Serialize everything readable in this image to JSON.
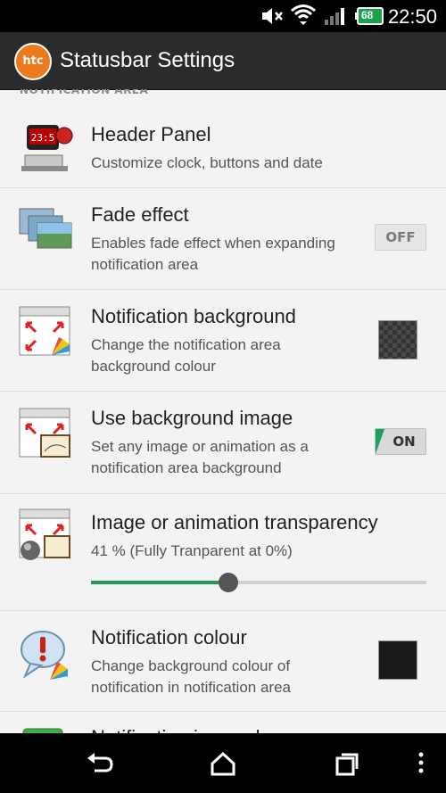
{
  "status_bar": {
    "time": "22:50",
    "battery_level": "68",
    "icons": [
      "mute-icon",
      "wifi-icon",
      "signal-icon",
      "battery-icon"
    ]
  },
  "app_bar": {
    "logo_text": "htc",
    "title": "Statusbar Settings"
  },
  "section": {
    "header": "NOTIFICATION AREA"
  },
  "settings": [
    {
      "title": "Header Panel",
      "subtitle": "Customize clock, buttons and date",
      "icon": "clock-header-icon"
    },
    {
      "title": "Fade effect",
      "subtitle": "Enables fade effect when expanding notification area",
      "icon": "fade-images-icon",
      "toggle": "OFF"
    },
    {
      "title": "Notification background",
      "subtitle": "Change the notification area background colour",
      "icon": "background-window-icon",
      "swatch_color": "#3a3a3a"
    },
    {
      "title": "Use background image",
      "subtitle": "Set any image or animation as a notification area background",
      "icon": "background-image-icon",
      "toggle": "ON"
    },
    {
      "title": "Image or animation transparency",
      "subtitle": "41 % (Fully Tranparent at 0%)",
      "icon": "transparency-icon",
      "slider_value_percent": 41
    },
    {
      "title": "Notification colour",
      "subtitle": "Change background colour of notification in notification area",
      "icon": "notification-bubble-icon",
      "swatch_color": "#1a1a1a"
    },
    {
      "title": "Notification icon colour",
      "icon": "notification-icon-colour-icon"
    }
  ],
  "nav_bar": {
    "icons": [
      "back-icon",
      "home-icon",
      "recents-icon",
      "overflow-menu-icon"
    ]
  },
  "colors": {
    "accent_green": "#1a9e57",
    "app_bar": "#2b2b2b",
    "htc_orange": "#ee7a1e"
  }
}
